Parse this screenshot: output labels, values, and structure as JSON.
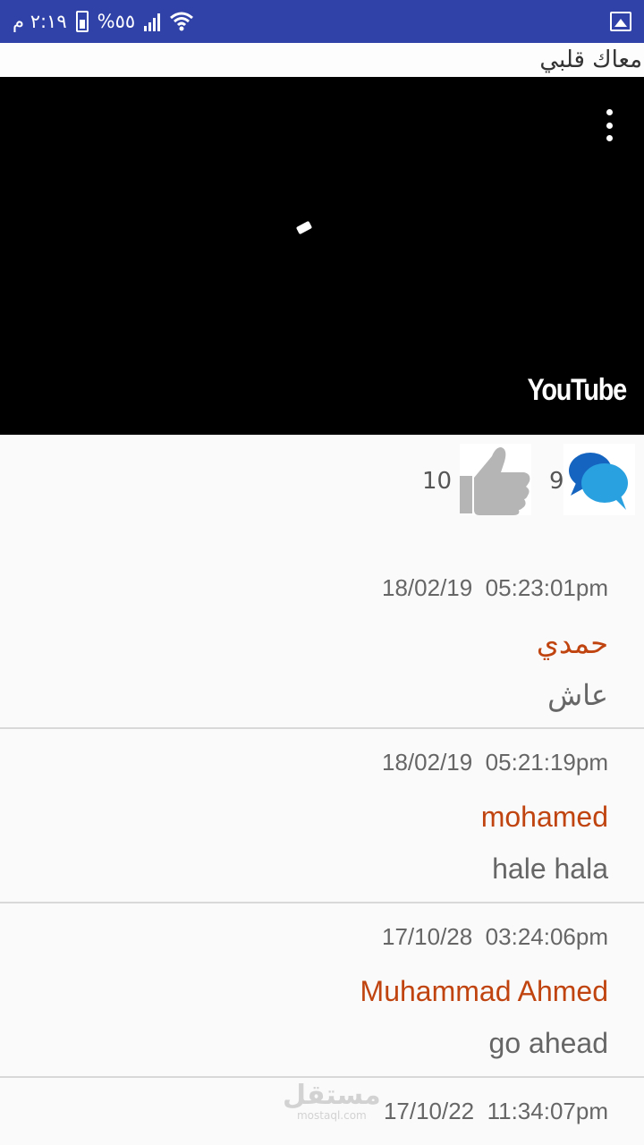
{
  "status_bar": {
    "time": "٢:١٩ م",
    "battery": "%٥٥",
    "colors": {
      "background": "#3041a8"
    },
    "icons": [
      "signal-icon",
      "battery-icon",
      "wifi-icon",
      "gallery-icon"
    ]
  },
  "title_bar": {
    "title": "معاك قلبي"
  },
  "video": {
    "logo": "YouTube",
    "icons": [
      "more-options-icon",
      "loading-spinner-icon"
    ]
  },
  "reactions": {
    "likes": "10",
    "comments": "9"
  },
  "comments": [
    {
      "time": "18/02/19  05:23:01pm",
      "name": "حمدي",
      "text": "عاش"
    },
    {
      "time": "18/02/19  05:21:19pm",
      "name": "mohamed",
      "text": "hale hala"
    },
    {
      "time": "17/10/28  03:24:06pm",
      "name": "Muhammad Ahmed",
      "text": "go ahead"
    },
    {
      "time": "17/10/22  11:34:07pm",
      "name": "",
      "text": ""
    }
  ],
  "watermark": {
    "main": "مستقل",
    "sub": "mostaql.com"
  },
  "colors": {
    "name": "#c0440f",
    "text": "#666666",
    "divider": "#d8d8d8"
  }
}
